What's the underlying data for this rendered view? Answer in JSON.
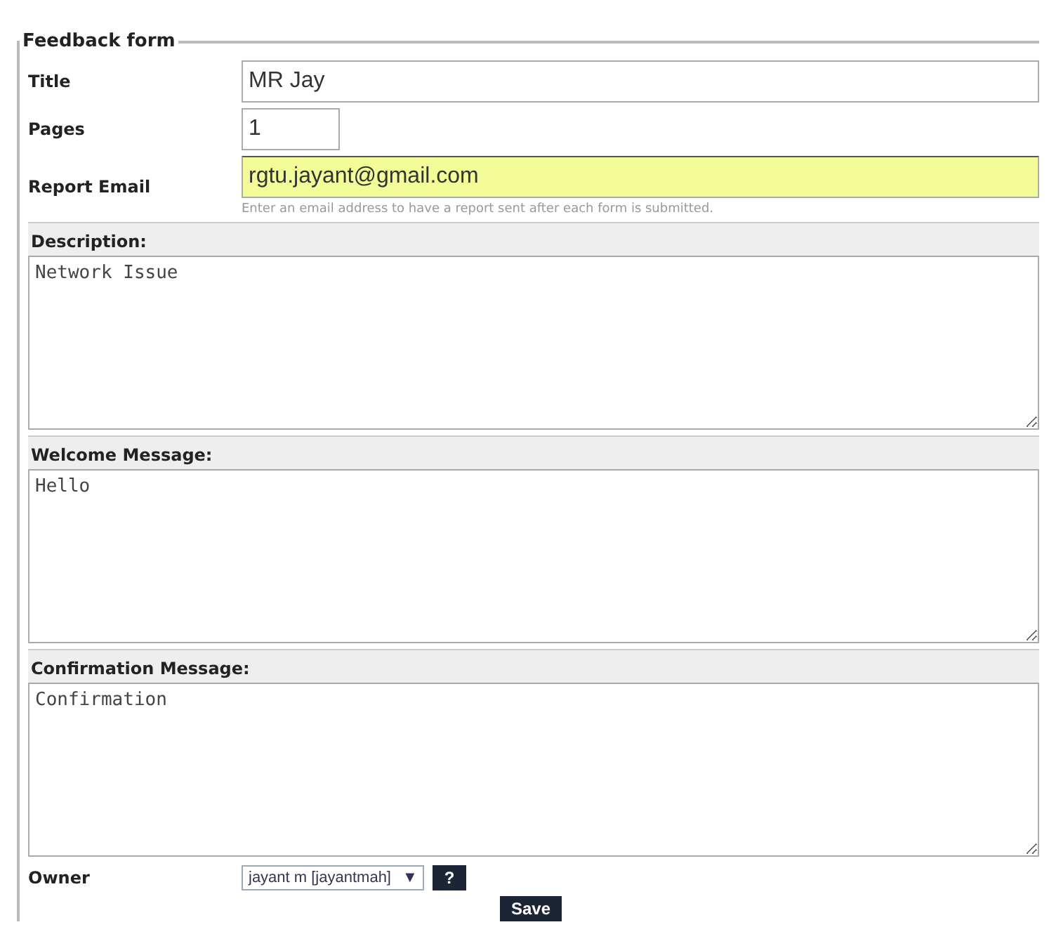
{
  "legend": "Feedback form",
  "fields": [
    {
      "label": "Title",
      "value": "MR Jay",
      "kind": "wide",
      "highlighted": false
    },
    {
      "label": "Pages",
      "value": "1",
      "kind": "short",
      "highlighted": false
    },
    {
      "label": "Report Email",
      "value": "rgtu.jayant@gmail.com",
      "kind": "wide",
      "highlighted": true,
      "hint": "Enter an email address to have a report sent after each form is submitted."
    }
  ],
  "text_areas": [
    {
      "label": "Description:",
      "value": "Network Issue"
    },
    {
      "label": "Welcome Message:",
      "value": "Hello"
    },
    {
      "label": "Confirmation Message:",
      "value": "Confirmation"
    }
  ],
  "owner": {
    "label": "Owner",
    "value": "jayant m [jayantmah]",
    "arrow": "▼",
    "help": "?"
  },
  "save": "Save"
}
